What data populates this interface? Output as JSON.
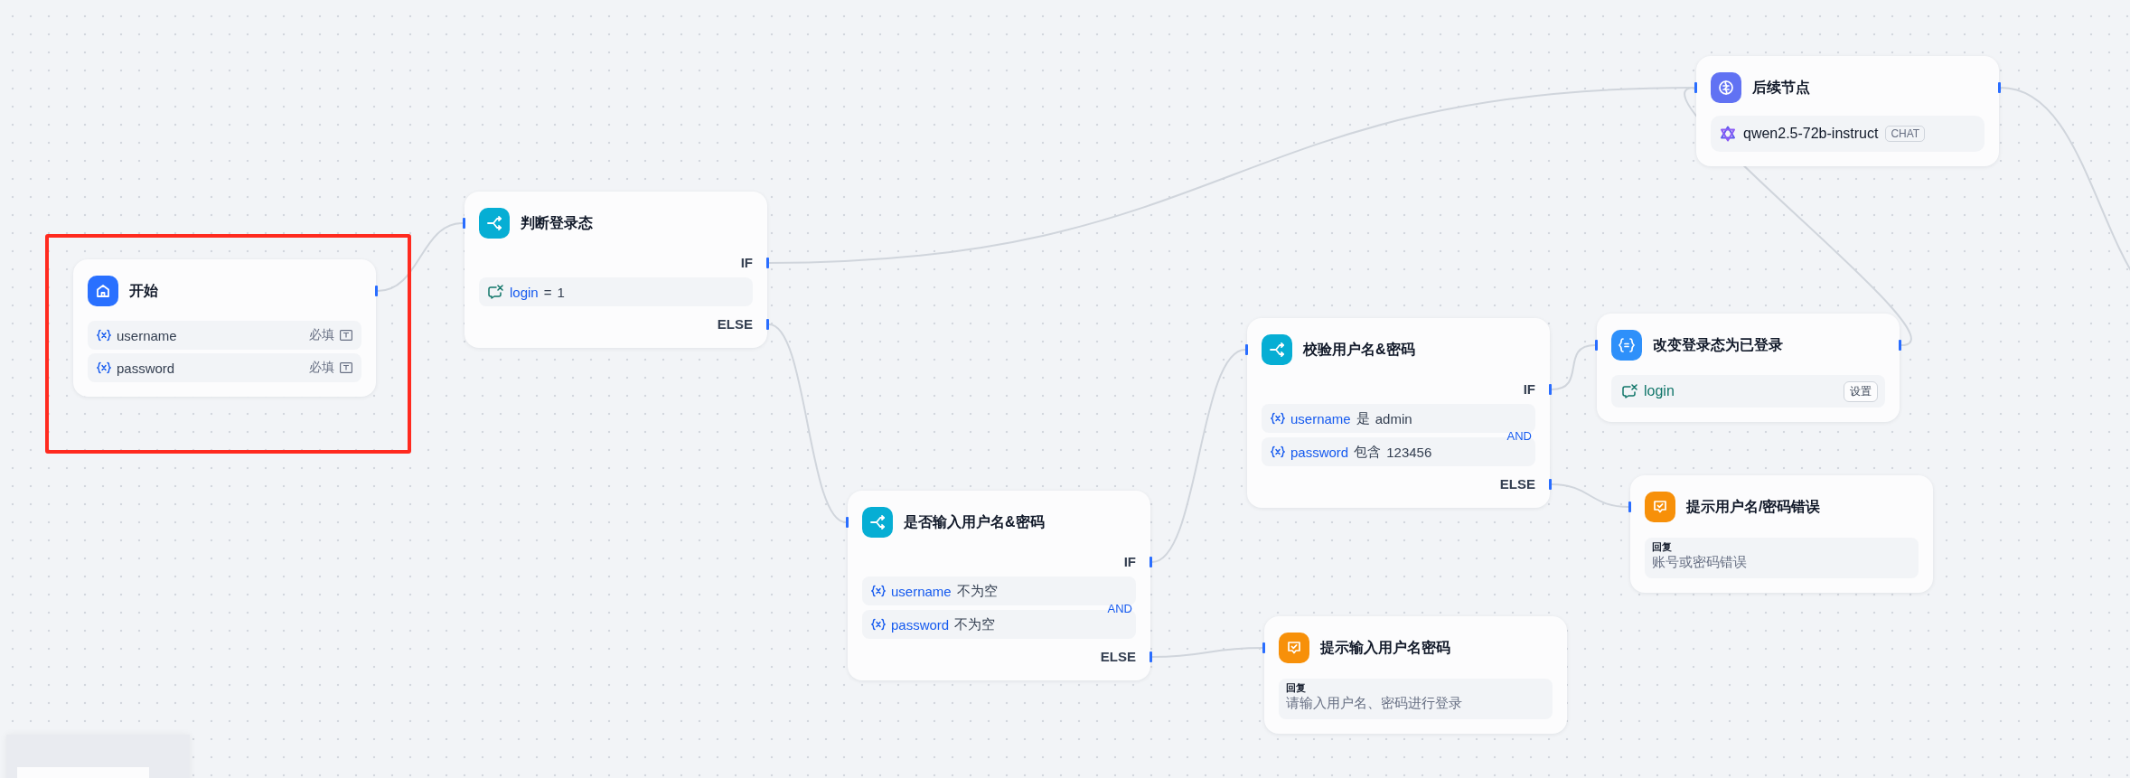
{
  "nodes": [
    {
      "kind": "start",
      "title": "开始",
      "highlighted": true,
      "variables": [
        {
          "name": "username",
          "required": "必填"
        },
        {
          "name": "password",
          "required": "必填"
        }
      ]
    },
    {
      "kind": "if_else",
      "title": "判断登录态",
      "if_label": "IF",
      "else_label": "ELSE",
      "conditions": [
        {
          "kind": "conversation",
          "variable": "login",
          "operator": "=",
          "value": "1"
        }
      ]
    },
    {
      "kind": "llm",
      "title": "后续节点",
      "model": "qwen2.5-72b-instruct",
      "mode": "CHAT"
    },
    {
      "kind": "if_else",
      "title": "是否输入用户名&密码",
      "if_label": "IF",
      "else_label": "ELSE",
      "logic": "AND",
      "conditions": [
        {
          "kind": "input",
          "variable": "username",
          "operator": "不为空"
        },
        {
          "kind": "input",
          "variable": "password",
          "operator": "不为空"
        }
      ]
    },
    {
      "kind": "if_else",
      "title": "校验用户名&密码",
      "if_label": "IF",
      "else_label": "ELSE",
      "logic": "AND",
      "conditions": [
        {
          "kind": "input",
          "variable": "username",
          "operator": "是",
          "value": "admin"
        },
        {
          "kind": "input",
          "variable": "password",
          "operator": "包含",
          "value": "123456"
        }
      ]
    },
    {
      "kind": "assigner",
      "title": "改变登录态为已登录",
      "variable": "login",
      "operation": "设置"
    },
    {
      "kind": "answer",
      "title": "提示用户名/密码错误",
      "label": "回复",
      "text": "账号或密码错误"
    },
    {
      "kind": "answer",
      "title": "提示输入用户名密码",
      "label": "回复",
      "text": "请输入用户名、密码进行登录"
    }
  ]
}
